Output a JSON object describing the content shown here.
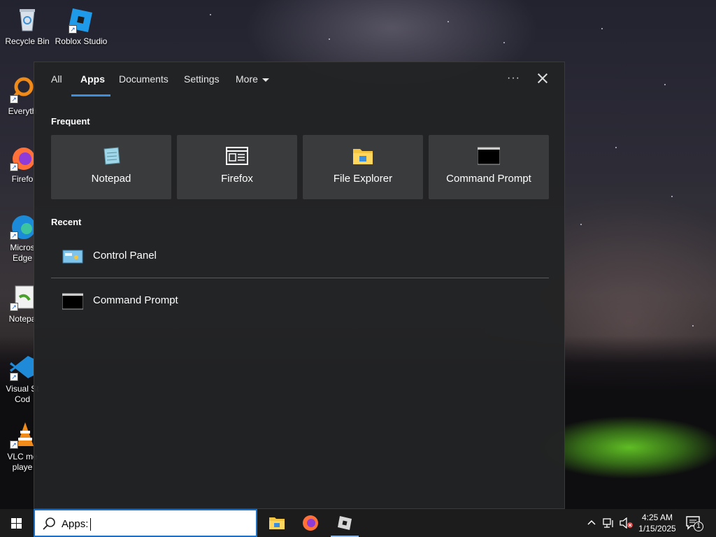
{
  "desktop": {
    "icons": [
      {
        "label": "Recycle Bin"
      },
      {
        "label": "Roblox Studio"
      },
      {
        "label": "Everyth"
      },
      {
        "label": "Firefo"
      },
      {
        "label": "Micros Edge"
      },
      {
        "label": "Notepa"
      },
      {
        "label": "Visual St Cod"
      },
      {
        "label": "VLC me playe"
      }
    ]
  },
  "panel": {
    "tabs": [
      {
        "label": "All"
      },
      {
        "label": "Apps"
      },
      {
        "label": "Documents"
      },
      {
        "label": "Settings"
      },
      {
        "label": "More"
      }
    ],
    "active_tab": "Apps",
    "more_icon": "ellipsis-icon",
    "close_icon": "close-icon",
    "frequent_heading": "Frequent",
    "frequent": [
      {
        "label": "Notepad",
        "icon": "notepad-icon"
      },
      {
        "label": "Firefox",
        "icon": "app-window-icon"
      },
      {
        "label": "File Explorer",
        "icon": "folder-icon"
      },
      {
        "label": "Command Prompt",
        "icon": "terminal-icon"
      }
    ],
    "recent_heading": "Recent",
    "recent": [
      {
        "label": "Control Panel",
        "icon": "control-panel-icon"
      },
      {
        "label": "Command Prompt",
        "icon": "terminal-icon"
      }
    ]
  },
  "taskbar": {
    "search_text": "Apps:",
    "accent": "#1f6fc4",
    "pinned": [
      {
        "name": "File Explorer",
        "icon": "folder-icon"
      },
      {
        "name": "Firefox",
        "icon": "firefox-icon"
      },
      {
        "name": "Roblox Studio",
        "icon": "roblox-icon"
      }
    ],
    "clock_time": "4:25 AM",
    "clock_date": "1/15/2025",
    "notification_count": "1"
  }
}
